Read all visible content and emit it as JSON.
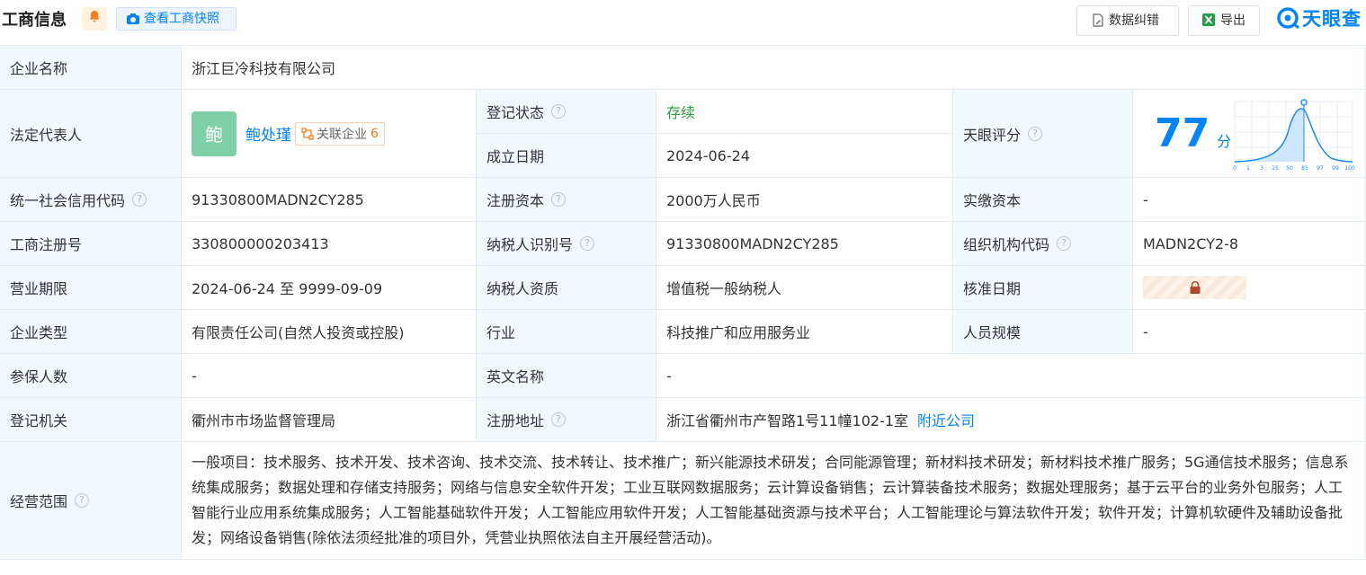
{
  "header": {
    "title": "工商信息",
    "snapshot_label": "查看工商快照",
    "correction_label": "数据纠错",
    "export_label": "导出",
    "logo_text": "天眼查"
  },
  "company": {
    "name_label": "企业名称",
    "name_value": "浙江巨冷科技有限公司",
    "legal_rep_label": "法定代表人",
    "legal_rep_avatar": "鲍",
    "legal_rep_name": "鲍处瑾",
    "assoc_label": "关联企业",
    "assoc_count": "6",
    "reg_status_label": "登记状态",
    "reg_status_value": "存续",
    "found_date_label": "成立日期",
    "found_date_value": "2024-06-24",
    "score_label": "天眼评分",
    "score_value": "77",
    "score_unit": "分",
    "credit_code_label": "统一社会信用代码",
    "credit_code_value": "91330800MADN2CY285",
    "reg_capital_label": "注册资本",
    "reg_capital_value": "2000万人民币",
    "paid_capital_label": "实缴资本",
    "paid_capital_value": "-",
    "reg_no_label": "工商注册号",
    "reg_no_value": "330800000203413",
    "taxpayer_id_label": "纳税人识别号",
    "taxpayer_id_value": "91330800MADN2CY285",
    "org_code_label": "组织机构代码",
    "org_code_value": "MADN2CY2-8",
    "term_label": "营业期限",
    "term_value": "2024-06-24 至 9999-09-09",
    "taxpayer_qual_label": "纳税人资质",
    "taxpayer_qual_value": "增值税一般纳税人",
    "approval_date_label": "核准日期",
    "type_label": "企业类型",
    "type_value": "有限责任公司(自然人投资或控股)",
    "industry_label": "行业",
    "industry_value": "科技推广和应用服务业",
    "staff_label": "人员规模",
    "staff_value": "-",
    "insured_label": "参保人数",
    "insured_value": "-",
    "en_name_label": "英文名称",
    "en_name_value": "-",
    "authority_label": "登记机关",
    "authority_value": "衢州市市场监督管理局",
    "address_label": "注册地址",
    "address_value": "浙江省衢州市产智路1号11幢102-1室",
    "nearby_label": "附近公司",
    "scope_label": "经营范围",
    "scope_value": "一般项目：技术服务、技术开发、技术咨询、技术交流、技术转让、技术推广；新兴能源技术研发；合同能源管理；新材料技术研发；新材料技术推广服务；5G通信技术服务；信息系统集成服务；数据处理和存储支持服务；网络与信息安全软件开发；工业互联网数据服务；云计算设备销售；云计算装备技术服务；数据处理服务；基于云平台的业务外包服务；人工智能行业应用系统集成服务；人工智能基础软件开发；人工智能应用软件开发；人工智能基础资源与技术平台；人工智能理论与算法软件开发；软件开发；计算机软硬件及辅助设备批发；网络设备销售(除依法须经批准的项目外，凭营业执照依法自主开展经营活动)。"
  },
  "score_chart": {
    "x_ticks": [
      "0",
      "1",
      "3",
      "15",
      "50",
      "85",
      "97",
      "99",
      "100"
    ],
    "marker_at": "77",
    "colors": {
      "curve": "#1a8cff",
      "fill": "#cfe6ff"
    }
  },
  "colors": {
    "accent": "#0084ff",
    "status_green": "#2e9c43",
    "label_bg": "#f2f8ff"
  }
}
